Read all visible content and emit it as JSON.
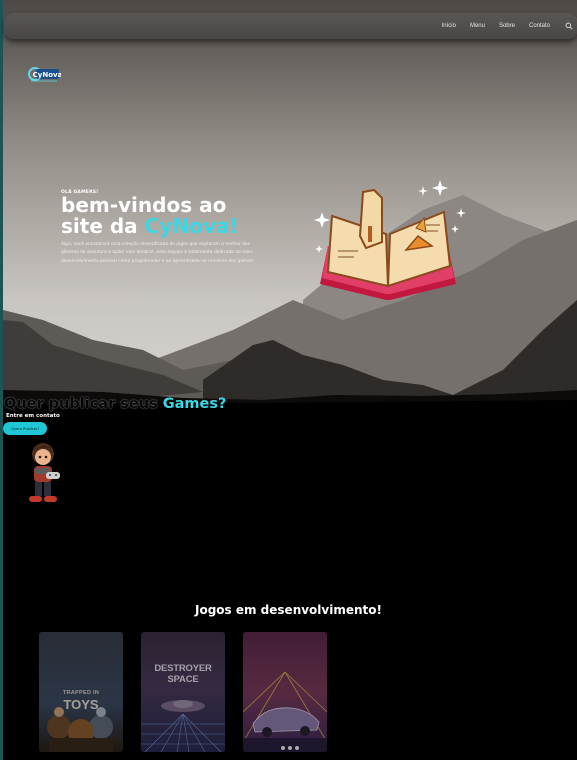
{
  "nav": {
    "links": [
      "Início",
      "Menu",
      "Sobre",
      "Contato"
    ],
    "search_icon": "search-icon"
  },
  "logo": {
    "text": "CyNova"
  },
  "hero": {
    "greeting": "OLÁ GAMERS!",
    "title_line1": "bem-vindos ao",
    "title_line2_prefix": "site da ",
    "title_accent": "CyNova!",
    "description": "Aqui, você encontrará uma coleção diversificada de jogos que exploram o melhor dos gêneros de aventura e ação! vale lembrar, este espaço é totalmente dedicado ao meu desenvolvimento pessoal como programador e ao aprendizado no universo dos games!",
    "image_icon": "magic-book-icon"
  },
  "publish": {
    "title_prefix": "Quer publicar seus ",
    "title_accent": "Games?",
    "contact_label": "Entre em contato",
    "button_label": "Quero Publicar!",
    "character_icon": "gamer-character-icon"
  },
  "games": {
    "title": "Jogos em desenvolvimento!",
    "cards": [
      {
        "caption_top": "TRAPPED IN",
        "caption_main": "TOYS"
      },
      {
        "caption_main": "DESTROYER SPACE"
      },
      {
        "caption_main": ""
      }
    ]
  },
  "colors": {
    "accent": "#3ed6e3",
    "button": "#1ec7d3",
    "background": "#000000"
  }
}
